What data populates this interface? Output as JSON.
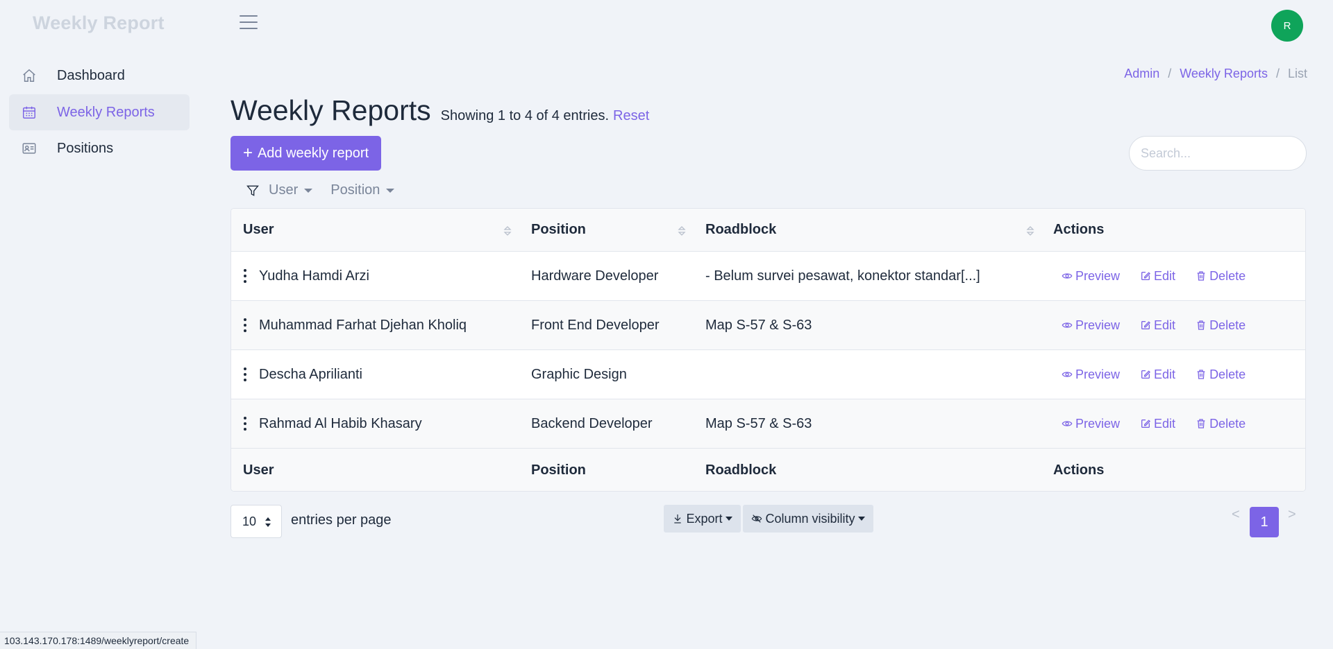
{
  "app": {
    "brand": "Weekly Report",
    "avatar_initial": "R"
  },
  "sidebar": {
    "items": [
      {
        "label": "Dashboard",
        "icon": "home-icon",
        "active": false
      },
      {
        "label": "Weekly Reports",
        "icon": "calendar-icon",
        "active": true
      },
      {
        "label": "Positions",
        "icon": "id-card-icon",
        "active": false
      }
    ]
  },
  "breadcrumb": {
    "items": [
      "Admin",
      "Weekly Reports",
      "List"
    ],
    "separator": "/"
  },
  "header": {
    "title": "Weekly Reports",
    "subtitle": "Showing 1 to 4 of 4 entries.",
    "reset_label": "Reset",
    "add_button_label": "Add weekly report"
  },
  "search": {
    "placeholder": "Search..."
  },
  "filters": {
    "items": [
      "User",
      "Position"
    ]
  },
  "table": {
    "columns": [
      "User",
      "Position",
      "Roadblock",
      "Actions"
    ],
    "rows": [
      {
        "user": "Yudha Hamdi Arzi",
        "position": "Hardware Developer",
        "roadblock": "- Belum survei pesawat, konektor standar[...]"
      },
      {
        "user": "Muhammad Farhat Djehan Kholiq",
        "position": "Front End Developer",
        "roadblock": "Map S-57 & S-63"
      },
      {
        "user": "Descha Aprilianti",
        "position": "Graphic Design",
        "roadblock": ""
      },
      {
        "user": "Rahmad Al Habib Khasary",
        "position": "Backend Developer",
        "roadblock": "Map S-57 & S-63"
      }
    ],
    "actions": {
      "preview": "Preview",
      "edit": "Edit",
      "delete": "Delete"
    }
  },
  "pagination": {
    "per_page_value": "10",
    "per_page_label": "entries per page",
    "prev": "<",
    "next": ">",
    "current_page": "1"
  },
  "toolbar": {
    "export_label": "Export",
    "column_visibility_label": "Column visibility"
  },
  "status_bar": {
    "url": "103.143.170.178:1489/weeklyreport/create"
  },
  "colors": {
    "accent": "#7c64e6",
    "avatar": "#0fa45a",
    "background": "#f0f3f8"
  }
}
